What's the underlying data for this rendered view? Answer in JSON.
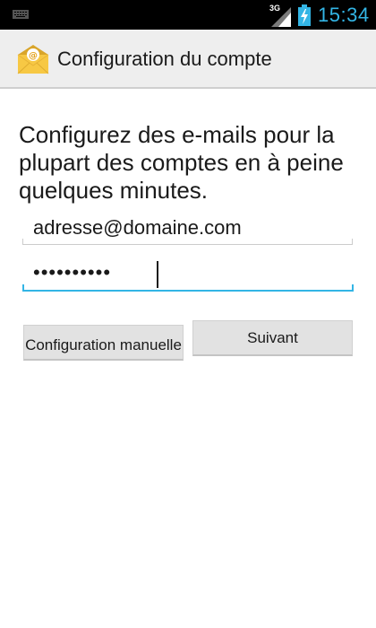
{
  "status_bar": {
    "network_type": "3G",
    "time": "15:34",
    "icons": [
      "keyboard-icon",
      "signal-icon",
      "battery-charging-icon"
    ]
  },
  "action_bar": {
    "title": "Configuration du compte",
    "icon": "email-icon"
  },
  "main": {
    "intro": "Configurez des e-mails pour la plupart des comptes en à peine quelques minutes.",
    "email_value": "adresse@domaine.com",
    "password_mask": "••••••••••",
    "manual_button_label": "Configuration manuelle",
    "next_button_label": "Suivant"
  },
  "colors": {
    "accent": "#33b5e5",
    "status_bar_bg": "#000000",
    "action_bar_bg": "#eeeeee"
  }
}
